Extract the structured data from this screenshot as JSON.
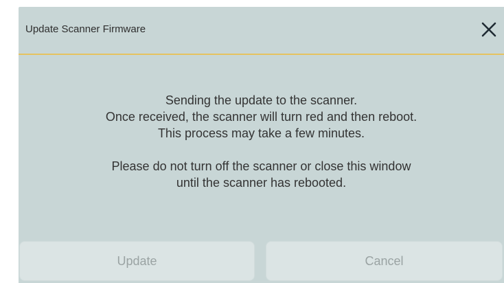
{
  "dialog": {
    "title": "Update Scanner Firmware",
    "close_icon": "close-icon",
    "message_lines": [
      "Sending the update to the scanner.",
      "Once received, the scanner will turn red and then reboot.",
      "This process may take a few minutes."
    ],
    "warning_lines": [
      "Please do not turn off the scanner or close this window",
      "until the scanner has rebooted."
    ],
    "buttons": {
      "update_label": "Update",
      "cancel_label": "Cancel"
    }
  },
  "colors": {
    "dialog_bg": "#c8d6d6",
    "title_divider": "#e6c35f",
    "button_bg": "#dbe4e4",
    "button_text_disabled": "#9aa3a3"
  }
}
